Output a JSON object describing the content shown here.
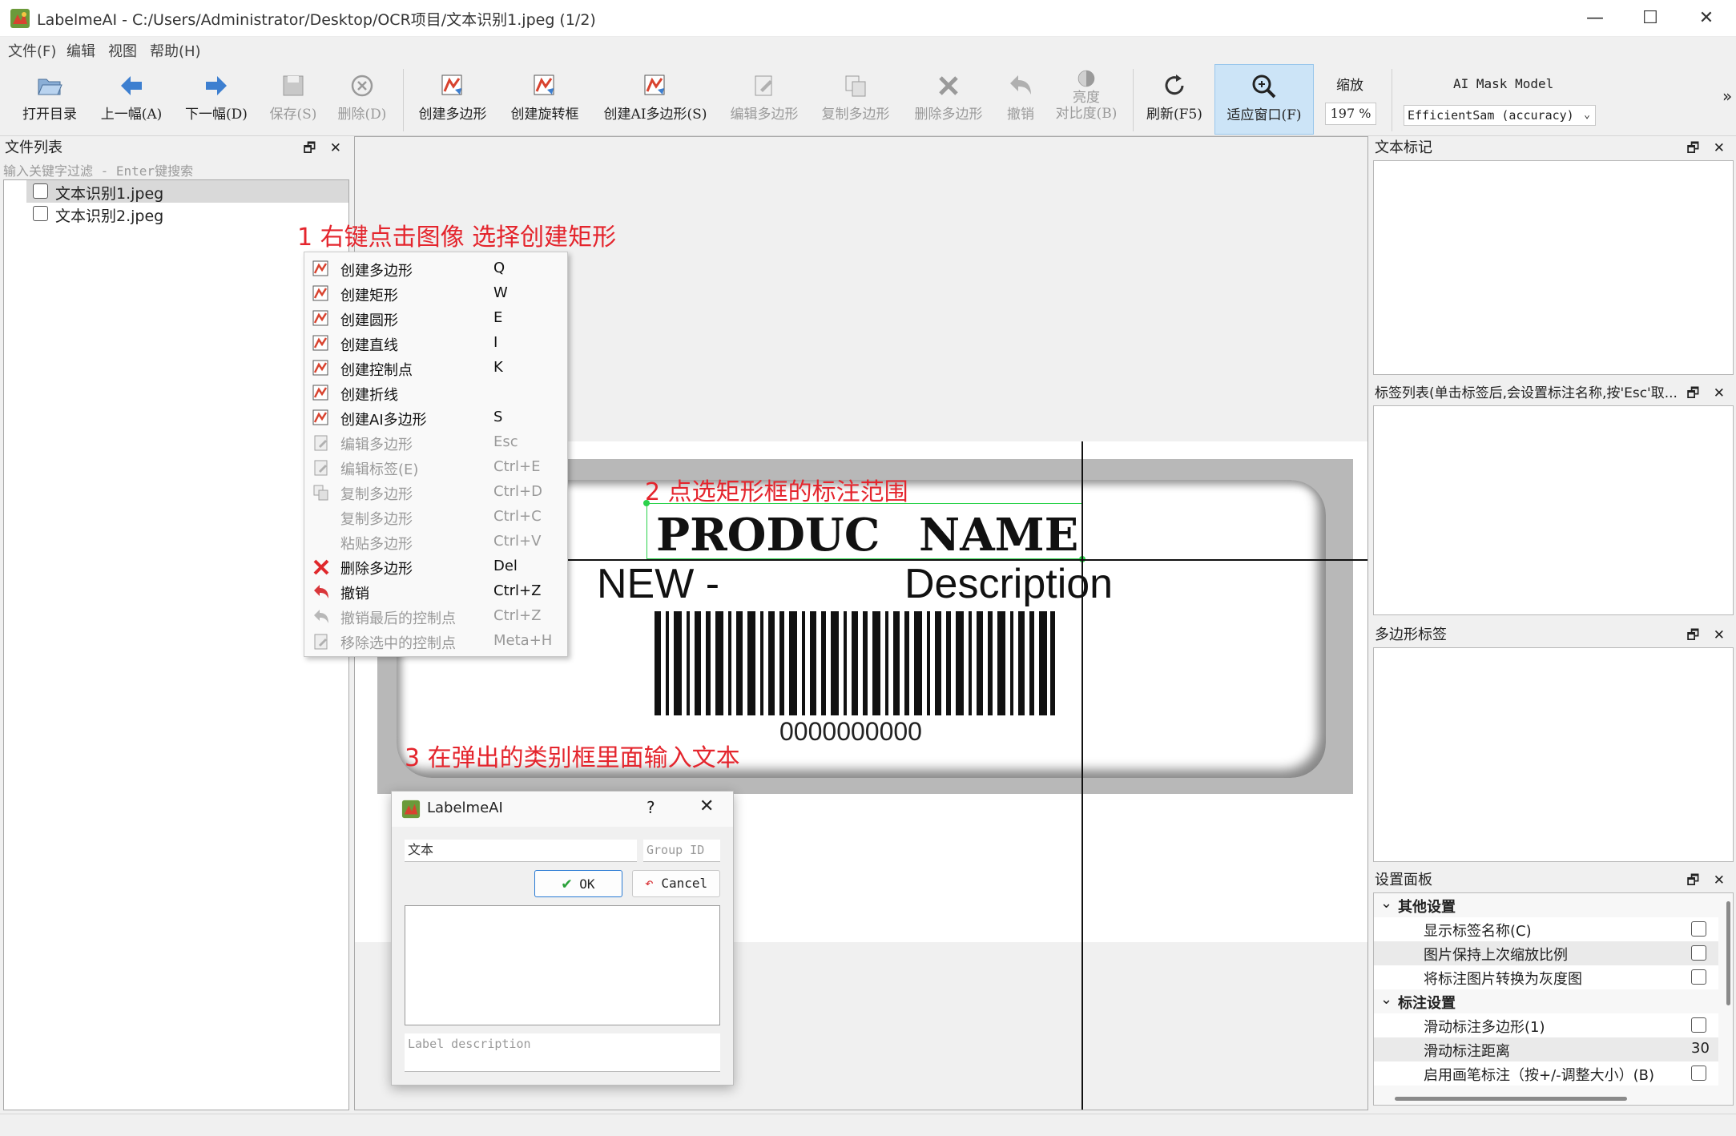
{
  "window": {
    "title": "LabelmeAI - C:/Users/Administrator/Desktop/OCR项目/文本识别1.jpeg (1/2)",
    "minimize": "—",
    "maximize": "☐",
    "close": "✕"
  },
  "menu": [
    "文件(F)",
    "编辑",
    "视图",
    "帮助(H)"
  ],
  "toolbar": {
    "open_dir": "打开目录",
    "prev": "上一幅(A)",
    "next": "下一幅(D)",
    "save": "保存(S)",
    "delete": "删除(D)",
    "create_polygon": "创建多边形",
    "create_rotation": "创建旋转框",
    "create_ai_polygon": "创建AI多边形(S)",
    "edit_polygon": "编辑多边形",
    "copy_polygon": "复制多边形",
    "delete_polygon": "删除多边形",
    "undo": "撤销",
    "brightness_1": "亮度",
    "brightness_2": "对比度(B)",
    "refresh": "刷新(F5)",
    "fit_window": "适应窗口(F)",
    "zoom_label": "缩放",
    "zoom_value": "197 %",
    "ai_model_label": "AI Mask Model",
    "ai_model_value": "EfficientSam (accuracy)",
    "overflow": "»"
  },
  "file_list": {
    "title": "文件列表",
    "filter_placeholder": "输入关键字过滤 - Enter键搜索",
    "items": [
      "文本识别1.jpeg",
      "文本识别2.jpeg"
    ]
  },
  "annotations": {
    "step1": "1 右键点击图像 选择创建矩形",
    "step2": "2 点选矩形框的标注范围",
    "step3": "3 在弹出的类别框里面输入文本"
  },
  "label_image": {
    "line1_a": "PRODUC",
    "line1_b": "NAME",
    "line2_a": "NEW -",
    "line2_b": "Description",
    "barcode_number": "0000000000"
  },
  "context_menu": [
    {
      "label": "创建多边形",
      "shortcut": "Q",
      "enabled": true
    },
    {
      "label": "创建矩形",
      "shortcut": "W",
      "enabled": true
    },
    {
      "label": "创建圆形",
      "shortcut": "E",
      "enabled": true
    },
    {
      "label": "创建直线",
      "shortcut": "I",
      "enabled": true
    },
    {
      "label": "创建控制点",
      "shortcut": "K",
      "enabled": true
    },
    {
      "label": "创建折线",
      "shortcut": "",
      "enabled": true
    },
    {
      "label": "创建AI多边形",
      "shortcut": "S",
      "enabled": true
    },
    {
      "label": "编辑多边形",
      "shortcut": "Esc",
      "enabled": false
    },
    {
      "label": "编辑标签(E)",
      "shortcut": "Ctrl+E",
      "enabled": false
    },
    {
      "label": "复制多边形",
      "shortcut": "Ctrl+D",
      "enabled": false
    },
    {
      "label": "复制多边形",
      "shortcut": "Ctrl+C",
      "enabled": false
    },
    {
      "label": "粘贴多边形",
      "shortcut": "Ctrl+V",
      "enabled": false
    },
    {
      "label": "删除多边形",
      "shortcut": "Del",
      "enabled": true
    },
    {
      "label": "撤销",
      "shortcut": "Ctrl+Z",
      "enabled": true
    },
    {
      "label": "撤销最后的控制点",
      "shortcut": "Ctrl+Z",
      "enabled": false
    },
    {
      "label": "移除选中的控制点",
      "shortcut": "Meta+H",
      "enabled": false
    }
  ],
  "dialog": {
    "title": "LabelmeAI",
    "help": "?",
    "close": "✕",
    "label_value": "文本",
    "group_placeholder": "Group ID",
    "ok": "OK",
    "cancel": "Cancel",
    "description_placeholder": "Label description"
  },
  "panels": {
    "text_mark": "文本标记",
    "label_list": "标签列表(单击标签后,会设置标注名称,按'Esc'取...",
    "polygon_labels": "多边形标签",
    "settings": "设置面板",
    "dock_btns": "🗗 ✕"
  },
  "settings": {
    "group1": "其他设置",
    "items1": [
      "显示标签名称(C)",
      "图片保持上次缩放比例",
      "将标注图片转换为灰度图"
    ],
    "group2": "标注设置",
    "items2": [
      "滑动标注多边形(1)",
      "滑动标注距离",
      "启用画笔标注（按+/-调整大小）(B)"
    ],
    "distance_value": "30"
  },
  "colors": {
    "accent_red": "#e4252d",
    "selection_green": "#2bd24b",
    "fit_active": "#cce4f7"
  }
}
